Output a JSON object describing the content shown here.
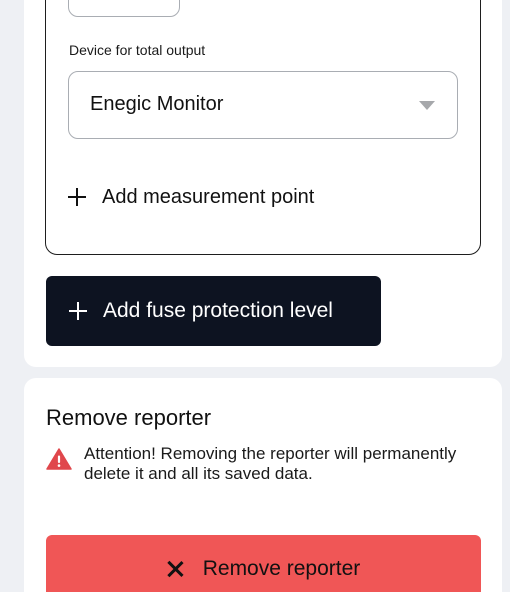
{
  "form": {
    "total_output_label": "Device for total output",
    "total_output_device": "Enegic Monitor",
    "add_measurement_point_label": "Add measurement point",
    "add_fuse_protection_label": "Add fuse protection level"
  },
  "remove_section": {
    "title": "Remove reporter",
    "warning_text": "Attention! Removing the reporter will permanently delete it and all its saved data.",
    "button_label": "Remove reporter"
  },
  "icons": {
    "select_caret": "chevron-down-icon",
    "add": "plus-icon",
    "warning": "warning-triangle-icon",
    "remove": "close-icon"
  },
  "colors": {
    "primary_dark": "#0d1321",
    "danger": "#f05656",
    "warning_icon": "#e0474c",
    "background": "#eef0f4"
  }
}
